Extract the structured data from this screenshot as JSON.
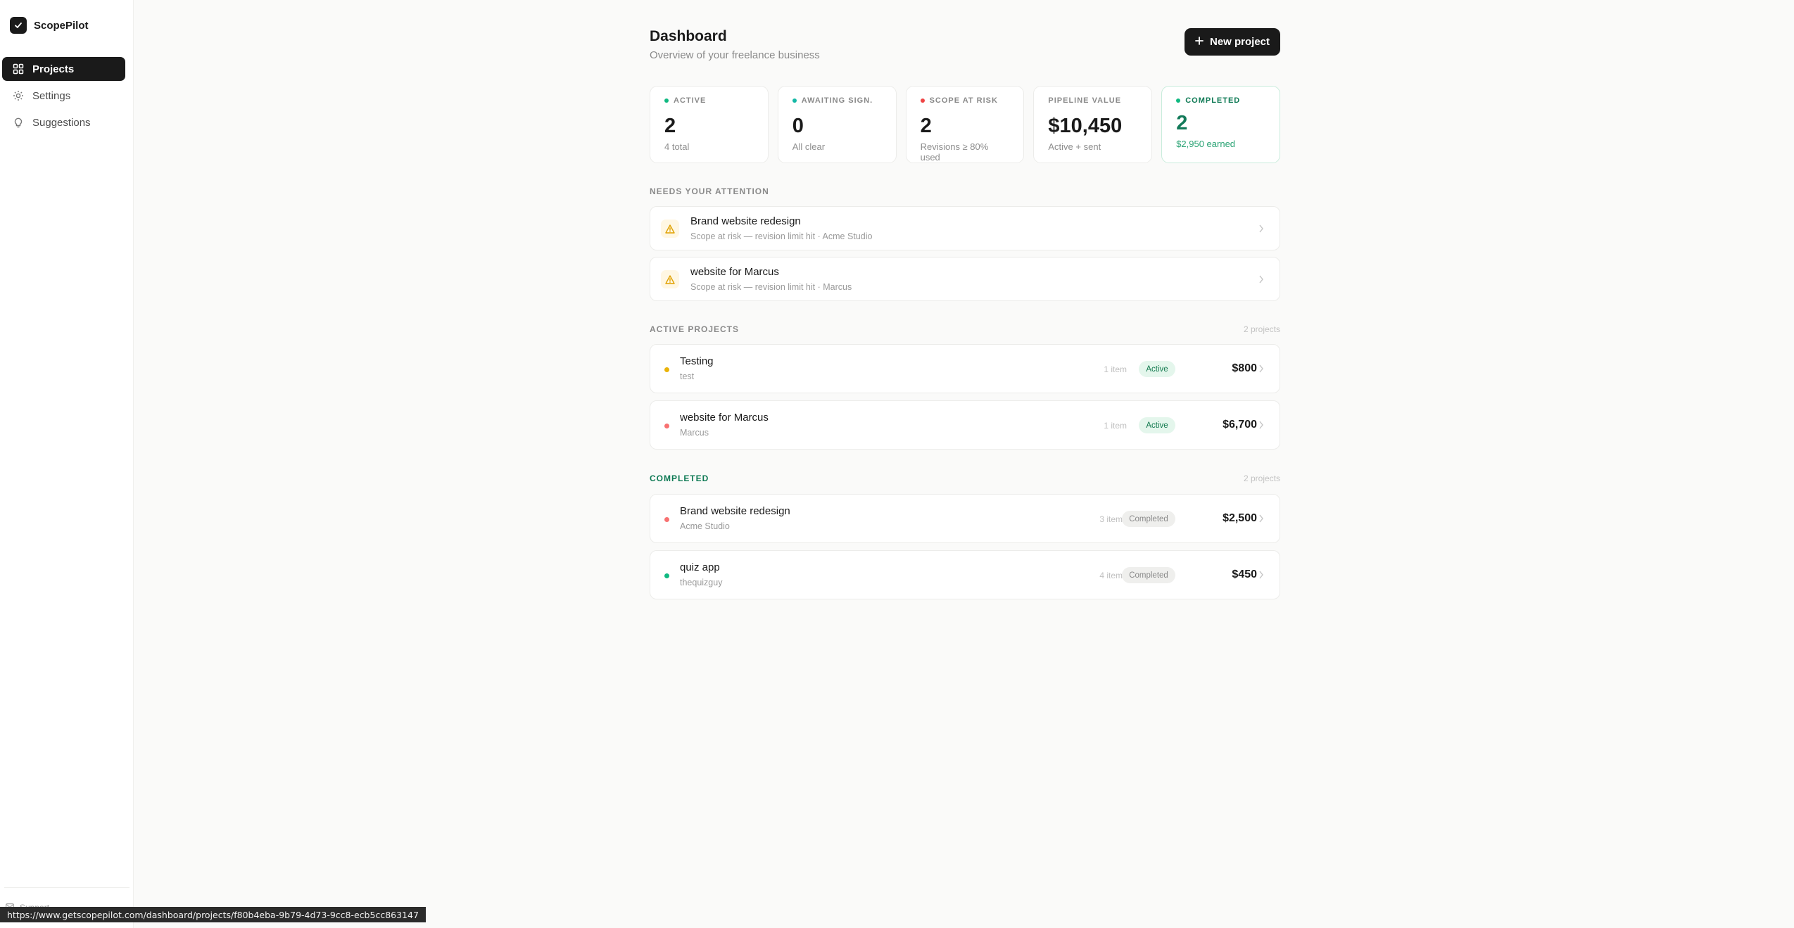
{
  "app": {
    "name": "ScopePilot"
  },
  "sidebar": {
    "items": [
      {
        "label": "Projects",
        "icon": "grid-icon",
        "active": true
      },
      {
        "label": "Settings",
        "icon": "gear-icon",
        "active": false
      },
      {
        "label": "Suggestions",
        "icon": "lightbulb-icon",
        "active": false
      }
    ],
    "footer_label": "Support"
  },
  "header": {
    "title": "Dashboard",
    "subtitle": "Overview of your freelance business",
    "new_button": "New project"
  },
  "stats": [
    {
      "label": "ACTIVE",
      "value": "2",
      "note": "4 total",
      "dot_color": "#10b981"
    },
    {
      "label": "AWAITING SIGN.",
      "value": "0",
      "note": "All clear",
      "dot_color": "#14b8a6"
    },
    {
      "label": "SCOPE AT RISK",
      "value": "2",
      "note": "Revisions ≥ 80% used",
      "dot_color": "#ef4444"
    },
    {
      "label": "PIPELINE VALUE",
      "value": "$10,450",
      "note": "Active + sent",
      "dot_color": null
    },
    {
      "label": "COMPLETED",
      "value": "2",
      "note": "$2,950 earned",
      "dot_color": "#10b981"
    }
  ],
  "attention": {
    "title": "NEEDS YOUR ATTENTION",
    "items": [
      {
        "title": "Brand website redesign",
        "subtitle": "Scope at risk — revision limit hit · Acme Studio",
        "icon": "warning-icon"
      },
      {
        "title": "website for Marcus",
        "subtitle": "Scope at risk — revision limit hit · Marcus",
        "icon": "warning-icon"
      }
    ]
  },
  "active_projects": {
    "title": "ACTIVE PROJECTS",
    "count": "2 projects",
    "items": [
      {
        "name": "Testing",
        "client": "test",
        "items": "1 item",
        "status": "Active",
        "price": "$800",
        "dot_color": "#eab308"
      },
      {
        "name": "website for Marcus",
        "client": "Marcus",
        "items": "1 item",
        "status": "Active",
        "price": "$6,700",
        "dot_color": "#f87171"
      }
    ]
  },
  "completed_projects": {
    "title": "COMPLETED",
    "count": "2 projects",
    "items": [
      {
        "name": "Brand website redesign",
        "client": "Acme Studio",
        "items": "3 items",
        "status": "Completed",
        "price": "$2,500",
        "dot_color": "#f87171"
      },
      {
        "name": "quiz app",
        "client": "thequizguy",
        "items": "4 items",
        "status": "Completed",
        "price": "$450",
        "dot_color": "#10b981"
      }
    ]
  },
  "status_bar": {
    "url": "https://www.getscopepilot.com/dashboard/projects/f80b4eba-9b79-4d73-9cc8-ecb5cc863147"
  }
}
